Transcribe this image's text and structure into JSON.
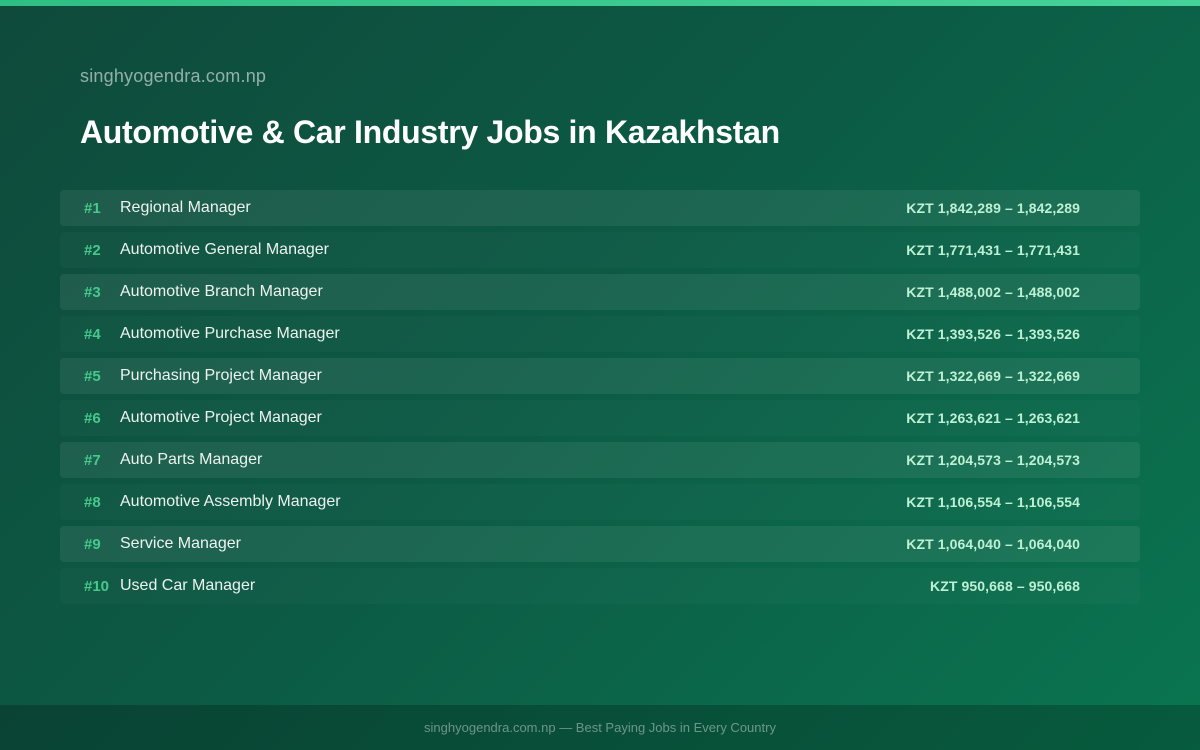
{
  "header": {
    "site": "singhyogendra.com.np",
    "title": "Automotive & Car Industry Jobs in Kazakhstan"
  },
  "jobs": [
    {
      "rank": "#1",
      "title": "Regional Manager",
      "salary": "KZT 1,842,289 – 1,842,289"
    },
    {
      "rank": "#2",
      "title": "Automotive General Manager",
      "salary": "KZT 1,771,431 – 1,771,431"
    },
    {
      "rank": "#3",
      "title": "Automotive Branch Manager",
      "salary": "KZT 1,488,002 – 1,488,002"
    },
    {
      "rank": "#4",
      "title": "Automotive Purchase Manager",
      "salary": "KZT 1,393,526 – 1,393,526"
    },
    {
      "rank": "#5",
      "title": "Purchasing Project Manager",
      "salary": "KZT 1,322,669 – 1,322,669"
    },
    {
      "rank": "#6",
      "title": "Automotive Project Manager",
      "salary": "KZT 1,263,621 – 1,263,621"
    },
    {
      "rank": "#7",
      "title": "Auto Parts Manager",
      "salary": "KZT 1,204,573 – 1,204,573"
    },
    {
      "rank": "#8",
      "title": "Automotive Assembly Manager",
      "salary": "KZT 1,106,554 – 1,106,554"
    },
    {
      "rank": "#9",
      "title": "Service Manager",
      "salary": "KZT 1,064,040 – 1,064,040"
    },
    {
      "rank": "#10",
      "title": "Used Car Manager",
      "salary": "KZT 950,668 – 950,668"
    }
  ],
  "footer": {
    "text": "singhyogendra.com.np — Best Paying Jobs in Every Country"
  },
  "colors": {
    "accent": "#45c98c",
    "salary": "#bdf0d5",
    "background_start": "#0f4a3b",
    "background_end": "#0a7550"
  }
}
